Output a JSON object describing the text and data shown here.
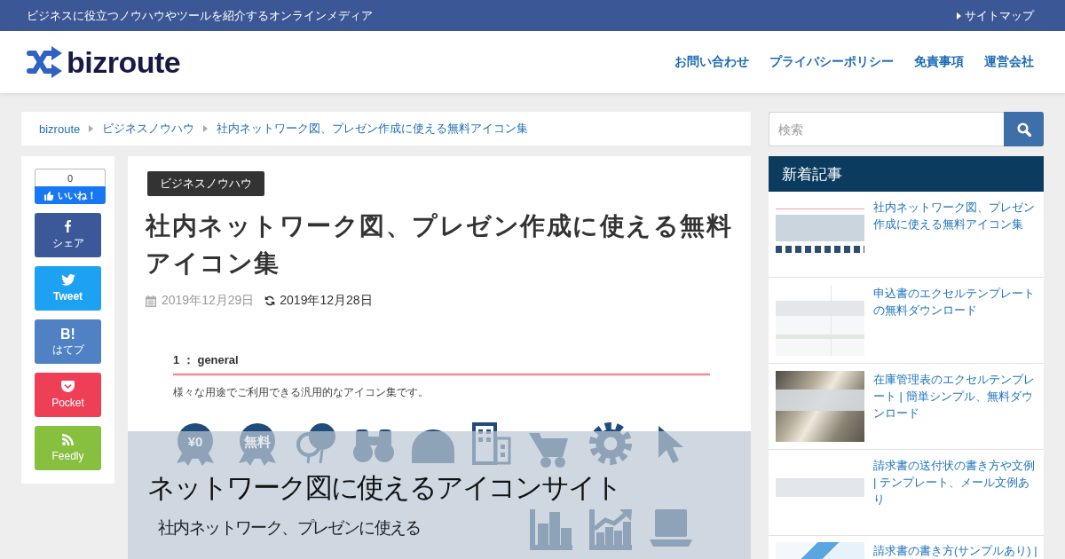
{
  "top_bar": {
    "tagline": "ビジネスに役立つノウハウやツールを紹介するオンラインメディア",
    "sitemap": "サイトマップ"
  },
  "header": {
    "logo": "bizroute",
    "nav": [
      "お問い合わせ",
      "プライバシーポリシー",
      "免責事項",
      "運営会社"
    ]
  },
  "breadcrumb": [
    "bizroute",
    "ビジネスノウハウ",
    "社内ネットワーク図、プレゼン作成に使える無料アイコン集"
  ],
  "share": {
    "like": {
      "count": "0",
      "label": "いいね！"
    },
    "buttons": [
      {
        "kind": "facebook",
        "label": "シェア"
      },
      {
        "kind": "twitter",
        "label": "Tweet"
      },
      {
        "kind": "hatena",
        "mark": "B!",
        "label": "はてブ"
      },
      {
        "kind": "pocket",
        "label": "Pocket"
      },
      {
        "kind": "feedly",
        "label": "Feedly"
      }
    ]
  },
  "article": {
    "category": "ビジネスノウハウ",
    "title": "社内ネットワーク図、プレゼン作成に使える無料アイコン集",
    "published": "2019年12月29日",
    "updated": "2019年12月28日",
    "featured_image": {
      "heading": "1 ： general",
      "caption": "様々な用途でご利用できる汎用的なアイコン集です。",
      "medals": [
        "¥0",
        "無料"
      ],
      "title": "ネットワーク図に使えるアイコンサイト",
      "subtitle": "社内ネットワーク、プレゼンに使える"
    }
  },
  "sidebar": {
    "search": {
      "placeholder": "検索"
    },
    "recent": {
      "heading": "新着記事",
      "items": [
        {
          "title": "社内ネットワーク図、プレゼン作成に使える無料アイコン集"
        },
        {
          "title": "申込書のエクセルテンプレートの無料ダウンロード"
        },
        {
          "title": "在庫管理表のエクセルテンプレート | 簡単シンプル、無料ダウンロード"
        },
        {
          "title": "請求書の送付状の書き方や文例 | テンプレート、メール文例あり"
        },
        {
          "title": "請求書の書き方(サンプルあり) |"
        }
      ]
    }
  }
}
